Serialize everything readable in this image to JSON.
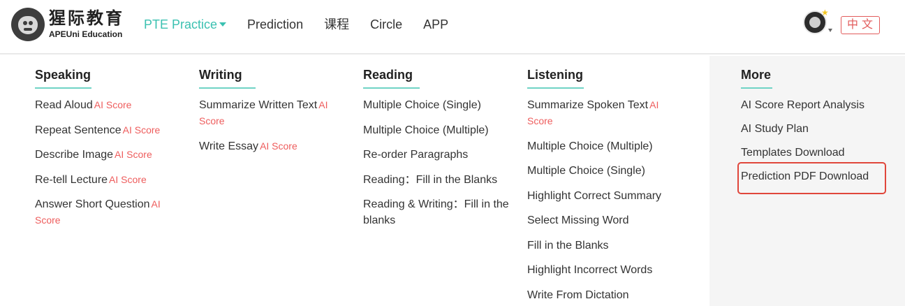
{
  "brand": {
    "name_cn": "猩际教育",
    "name_en": "APEUni Education"
  },
  "nav": {
    "items": [
      "PTE Practice",
      "Prediction",
      "课程",
      "Circle",
      "APP"
    ]
  },
  "header": {
    "lang_label": "中文"
  },
  "ai_badge": "AI Score",
  "menu": {
    "speaking": {
      "title": "Speaking",
      "items": [
        "Read Aloud",
        "Repeat Sentence",
        "Describe Image",
        "Re-tell Lecture",
        "Answer Short Question"
      ]
    },
    "writing": {
      "title": "Writing",
      "items": [
        "Summarize Written Text",
        "Write Essay"
      ]
    },
    "reading": {
      "title": "Reading",
      "items": [
        "Multiple Choice (Single)",
        "Multiple Choice (Multiple)",
        "Re-order Paragraphs",
        "Reading：Fill in the Blanks",
        "Reading & Writing：Fill in the blanks"
      ]
    },
    "listening": {
      "title": "Listening",
      "items": [
        "Summarize Spoken Text",
        "Multiple Choice (Multiple)",
        "Multiple Choice (Single)",
        "Highlight Correct Summary",
        "Select Missing Word",
        "Fill in the Blanks",
        "Highlight Incorrect Words",
        "Write From Dictation"
      ]
    },
    "more": {
      "title": "More",
      "items": [
        "AI Score Report Analysis",
        "AI Study Plan",
        "Templates Download",
        "Prediction PDF Download"
      ]
    }
  },
  "colors": {
    "accent": "#3bc1b1",
    "ai_score": "#ee5d5d",
    "highlight_border": "#e0463b"
  }
}
